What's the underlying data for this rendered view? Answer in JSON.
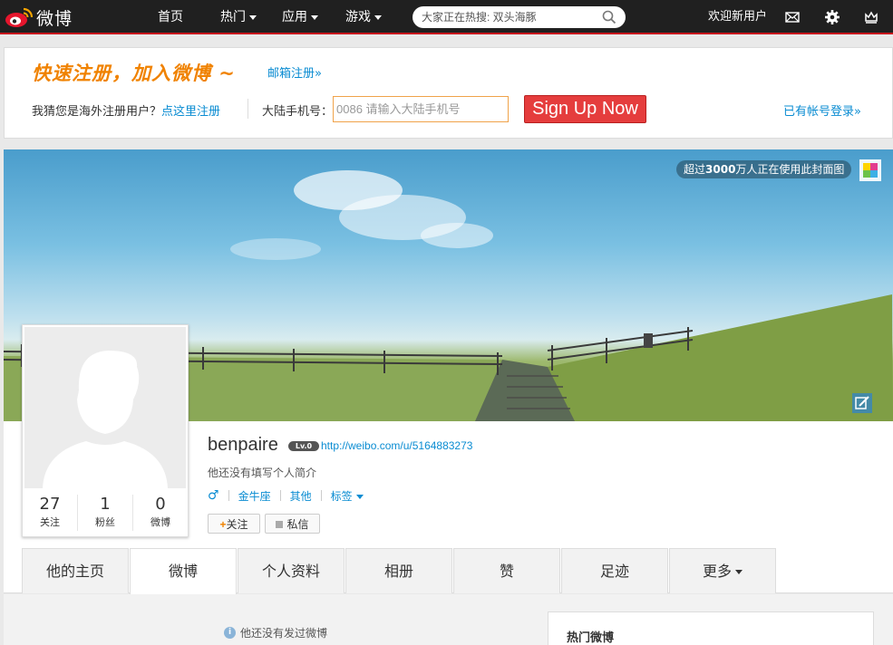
{
  "topnav": {
    "logo_text": "微博",
    "items": [
      {
        "label": "首页"
      },
      {
        "label": "热门"
      },
      {
        "label": "应用"
      },
      {
        "label": "游戏"
      }
    ],
    "search_placeholder": "大家正在热搜: 双头海豚",
    "welcome": "欢迎新用户",
    "icons": [
      "mail-icon",
      "gear-icon",
      "crown-icon"
    ]
  },
  "register": {
    "title": "快速注册，加入微博 ~",
    "email_link": "邮箱注册»",
    "overseas_text": "我猜您是海外注册用户？",
    "overseas_link": "点这里注册",
    "phone_label": "大陆手机号：",
    "phone_placeholder": "0086 请输入大陆手机号",
    "signup_button": "Sign Up Now",
    "login_link": "已有帐号登录»"
  },
  "profile": {
    "cover_badge_prefix": "超过",
    "cover_badge_number": "3000",
    "cover_badge_suffix": "万人正在使用此封面图",
    "username": "benpaire",
    "level": "Lv.0",
    "url": "http://weibo.com/u/5164883273",
    "bio": "他还没有填写个人简介",
    "gender_symbol": "♂",
    "constellation": "金牛座",
    "other": "其他",
    "tags": "标签",
    "follow_button": "关注",
    "follow_plus": "+",
    "message_button": "私信",
    "counts": [
      {
        "num": "27",
        "label": "关注"
      },
      {
        "num": "1",
        "label": "粉丝"
      },
      {
        "num": "0",
        "label": "微博"
      }
    ]
  },
  "tabs": [
    {
      "label": "他的主页"
    },
    {
      "label": "微博"
    },
    {
      "label": "个人资料"
    },
    {
      "label": "相册"
    },
    {
      "label": "赞"
    },
    {
      "label": "足迹"
    },
    {
      "label": "更多"
    }
  ],
  "content": {
    "empty_message": "他还没有发过微博",
    "info_glyph": "i",
    "hot_title": "热门微博"
  },
  "colors": {
    "accent_red": "#c8161d",
    "link_blue": "#0a8cd2",
    "orange": "#f08200",
    "signup_red": "#e53d3d"
  }
}
